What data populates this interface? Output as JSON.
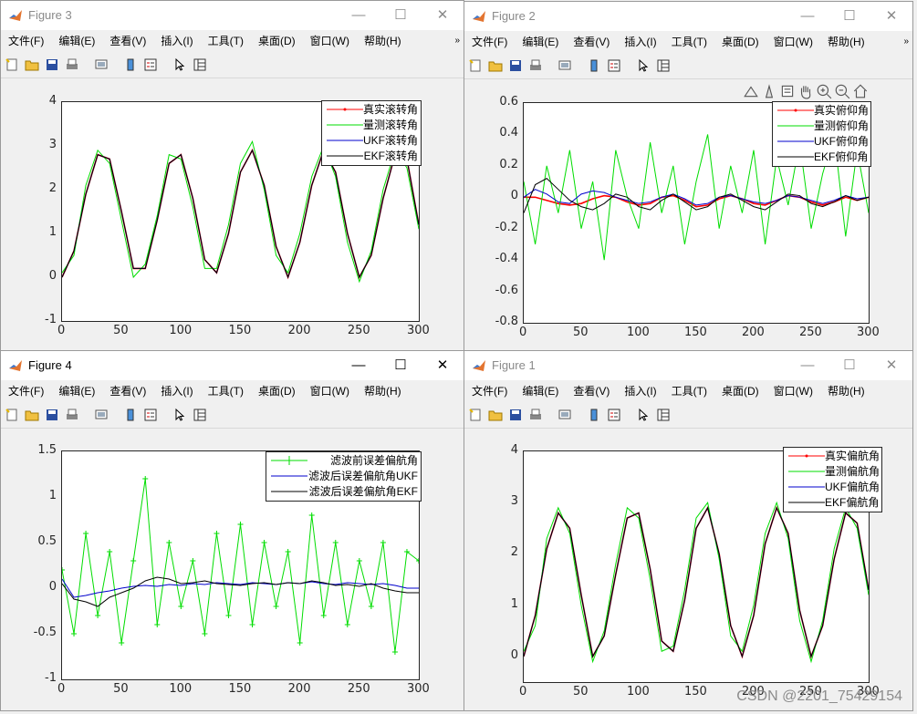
{
  "menus": [
    "文件(F)",
    "编辑(E)",
    "查看(V)",
    "插入(I)",
    "工具(T)",
    "桌面(D)",
    "窗口(W)",
    "帮助(H)"
  ],
  "more_glyph": "»",
  "watermark": "CSDN @2201_75429154",
  "colors": {
    "red": "#ff0000",
    "green": "#00dd00",
    "blue": "#0000cc",
    "black": "#000000",
    "accent": "#0072bd"
  },
  "windows": [
    {
      "id": "fig3",
      "title": "Figure 3",
      "active": false,
      "legend": [
        "真实滚转角",
        "量测滚转角",
        "UKF滚转角",
        "EKF滚转角"
      ],
      "yticks": [
        "4",
        "3",
        "2",
        "1",
        "0",
        "-1"
      ],
      "xticks": [
        "0",
        "50",
        "100",
        "150",
        "200",
        "250",
        "300"
      ],
      "chart_data": {
        "type": "line",
        "xlim": [
          0,
          300
        ],
        "ylim": [
          -1,
          4
        ],
        "x": [
          0,
          10,
          20,
          30,
          40,
          50,
          60,
          70,
          80,
          90,
          100,
          110,
          120,
          130,
          140,
          150,
          160,
          170,
          180,
          190,
          200,
          210,
          220,
          230,
          240,
          250,
          260,
          270,
          280,
          290,
          300
        ],
        "series": [
          {
            "name": "真实滚转角",
            "values": [
              0.0,
              0.6,
              1.9,
              2.8,
              2.7,
              1.5,
              0.2,
              0.2,
              1.3,
              2.6,
              2.8,
              1.8,
              0.4,
              0.1,
              1.0,
              2.4,
              2.9,
              2.1,
              0.7,
              0.0,
              0.8,
              2.1,
              2.9,
              2.4,
              1.0,
              0.0,
              0.5,
              1.8,
              2.8,
              2.7,
              1.2
            ]
          },
          {
            "name": "量测滚转角",
            "values": [
              0.1,
              0.5,
              2.1,
              2.9,
              2.6,
              1.3,
              0.0,
              0.3,
              1.4,
              2.8,
              2.7,
              1.6,
              0.2,
              0.2,
              1.2,
              2.6,
              3.1,
              2.0,
              0.5,
              0.1,
              1.0,
              2.3,
              3.0,
              2.3,
              0.8,
              -0.1,
              0.6,
              2.0,
              2.9,
              2.5,
              1.1
            ]
          },
          {
            "name": "UKF滚转角",
            "values": [
              0.0,
              0.6,
              1.9,
              2.8,
              2.7,
              1.5,
              0.2,
              0.2,
              1.3,
              2.6,
              2.8,
              1.8,
              0.4,
              0.1,
              1.0,
              2.4,
              2.9,
              2.1,
              0.7,
              0.0,
              0.8,
              2.1,
              2.9,
              2.4,
              1.0,
              0.0,
              0.5,
              1.8,
              2.8,
              2.7,
              1.2
            ]
          },
          {
            "name": "EKF滚转角",
            "values": [
              0.0,
              0.6,
              1.9,
              2.8,
              2.7,
              1.5,
              0.2,
              0.2,
              1.3,
              2.6,
              2.8,
              1.8,
              0.4,
              0.1,
              1.0,
              2.4,
              2.9,
              2.1,
              0.7,
              0.0,
              0.8,
              2.1,
              2.9,
              2.4,
              1.0,
              0.0,
              0.5,
              1.8,
              2.8,
              2.7,
              1.2
            ]
          }
        ]
      }
    },
    {
      "id": "fig2",
      "title": "Figure 2",
      "active": false,
      "legend": [
        "真实俯仰角",
        "量测俯仰角",
        "UKF俯仰角",
        "EKF俯仰角"
      ],
      "yticks": [
        "0.6",
        "0.4",
        "0.2",
        "0",
        "-0.2",
        "-0.4",
        "-0.6",
        "-0.8"
      ],
      "xticks": [
        "0",
        "50",
        "100",
        "150",
        "200",
        "250",
        "300"
      ],
      "chart_data": {
        "type": "line",
        "xlim": [
          0,
          300
        ],
        "ylim": [
          -0.8,
          0.6
        ],
        "x": [
          0,
          10,
          20,
          30,
          40,
          50,
          60,
          70,
          80,
          90,
          100,
          110,
          120,
          130,
          140,
          150,
          160,
          170,
          180,
          190,
          200,
          210,
          220,
          230,
          240,
          250,
          260,
          270,
          280,
          290,
          300
        ],
        "series": [
          {
            "name": "真实俯仰角",
            "values": [
              0.0,
              0.0,
              -0.02,
              -0.04,
              -0.05,
              -0.04,
              -0.01,
              0.01,
              0.0,
              -0.03,
              -0.05,
              -0.04,
              0.0,
              0.01,
              -0.02,
              -0.06,
              -0.05,
              -0.01,
              0.01,
              -0.01,
              -0.04,
              -0.05,
              -0.02,
              0.01,
              0.0,
              -0.03,
              -0.05,
              -0.03,
              0.0,
              -0.02,
              0.0
            ]
          },
          {
            "name": "量测俯仰角",
            "values": [
              0.1,
              -0.3,
              0.2,
              -0.1,
              0.3,
              -0.2,
              0.1,
              -0.4,
              0.3,
              0.0,
              -0.2,
              0.35,
              -0.1,
              0.2,
              -0.3,
              0.1,
              0.4,
              -0.2,
              0.2,
              -0.1,
              0.3,
              -0.3,
              0.25,
              -0.05,
              0.35,
              -0.2,
              0.15,
              0.4,
              -0.25,
              0.3,
              -0.1
            ]
          },
          {
            "name": "UKF俯仰角",
            "values": [
              0.0,
              0.05,
              0.02,
              -0.03,
              -0.04,
              0.02,
              0.04,
              0.03,
              0.0,
              -0.02,
              -0.04,
              -0.03,
              0.0,
              0.02,
              -0.01,
              -0.05,
              -0.04,
              0.0,
              0.01,
              -0.01,
              -0.03,
              -0.04,
              -0.02,
              0.01,
              0.0,
              -0.02,
              -0.04,
              -0.02,
              0.01,
              -0.01,
              0.0
            ]
          },
          {
            "name": "EKF俯仰角",
            "values": [
              -0.1,
              0.08,
              0.12,
              0.05,
              -0.02,
              -0.06,
              -0.08,
              -0.04,
              0.02,
              0.0,
              -0.06,
              -0.08,
              -0.02,
              0.02,
              -0.03,
              -0.08,
              -0.06,
              0.0,
              0.02,
              -0.02,
              -0.06,
              -0.08,
              -0.03,
              0.02,
              0.01,
              -0.04,
              -0.06,
              -0.03,
              0.01,
              -0.02,
              0.0
            ]
          }
        ]
      }
    },
    {
      "id": "fig4",
      "title": "Figure 4",
      "active": true,
      "legend": [
        "滤波前误差偏航角",
        "滤波后误差偏航角UKF",
        "滤波后误差偏航角EKF"
      ],
      "yticks": [
        "1.5",
        "1",
        "0.5",
        "0",
        "-0.5",
        "-1"
      ],
      "xticks": [
        "0",
        "50",
        "100",
        "150",
        "200",
        "250",
        "300"
      ],
      "chart_data": {
        "type": "line",
        "xlim": [
          0,
          300
        ],
        "ylim": [
          -1,
          1.5
        ],
        "x": [
          0,
          10,
          20,
          30,
          40,
          50,
          60,
          70,
          80,
          90,
          100,
          110,
          120,
          130,
          140,
          150,
          160,
          170,
          180,
          190,
          200,
          210,
          220,
          230,
          240,
          250,
          260,
          270,
          280,
          290,
          300
        ],
        "series": [
          {
            "name": "滤波前误差偏航角",
            "values": [
              0.2,
              -0.5,
              0.6,
              -0.3,
              0.4,
              -0.6,
              0.3,
              1.2,
              -0.4,
              0.5,
              -0.2,
              0.3,
              -0.5,
              0.6,
              -0.3,
              0.7,
              -0.4,
              0.5,
              -0.2,
              0.4,
              -0.6,
              0.8,
              -0.3,
              0.5,
              -0.4,
              0.3,
              -0.2,
              0.5,
              -0.7,
              0.4,
              0.3
            ]
          },
          {
            "name": "滤波后误差偏航角UKF",
            "values": [
              0.1,
              -0.1,
              -0.08,
              -0.05,
              -0.03,
              0.0,
              0.02,
              0.03,
              0.02,
              0.04,
              0.03,
              0.05,
              0.04,
              0.06,
              0.05,
              0.04,
              0.06,
              0.05,
              0.04,
              0.06,
              0.05,
              0.07,
              0.05,
              0.04,
              0.06,
              0.05,
              0.04,
              0.05,
              0.03,
              0.0,
              0.0
            ]
          },
          {
            "name": "滤波后误差偏航角EKF",
            "values": [
              0.05,
              -0.12,
              -0.15,
              -0.2,
              -0.1,
              -0.05,
              0.0,
              0.08,
              0.12,
              0.1,
              0.05,
              0.06,
              0.08,
              0.05,
              0.04,
              0.03,
              0.05,
              0.06,
              0.04,
              0.06,
              0.05,
              0.08,
              0.06,
              0.03,
              0.04,
              0.02,
              0.05,
              0.0,
              -0.03,
              -0.05,
              -0.05
            ]
          }
        ]
      }
    },
    {
      "id": "fig1",
      "title": "Figure 1",
      "active": false,
      "legend": [
        "真实偏航角",
        "量测偏航角",
        "UKF偏航角",
        "EKF偏航角"
      ],
      "yticks": [
        "4",
        "3",
        "2",
        "1",
        "0"
      ],
      "xticks": [
        "0",
        "50",
        "100",
        "150",
        "200",
        "250",
        "300"
      ],
      "chart_data": {
        "type": "line",
        "xlim": [
          0,
          300
        ],
        "ylim": [
          -0.5,
          4
        ],
        "x": [
          0,
          10,
          20,
          30,
          40,
          50,
          60,
          70,
          80,
          90,
          100,
          110,
          120,
          130,
          140,
          150,
          160,
          170,
          180,
          190,
          200,
          210,
          220,
          230,
          240,
          250,
          260,
          270,
          280,
          290,
          300
        ],
        "series": [
          {
            "name": "真实偏航角",
            "values": [
              0.0,
              0.8,
              2.1,
              2.8,
              2.5,
              1.2,
              0.0,
              0.4,
              1.6,
              2.7,
              2.8,
              1.7,
              0.3,
              0.1,
              1.1,
              2.5,
              2.9,
              2.0,
              0.6,
              0.0,
              0.8,
              2.2,
              2.9,
              2.4,
              0.9,
              0.0,
              0.6,
              1.9,
              2.8,
              2.6,
              1.3
            ]
          },
          {
            "name": "量测偏航角",
            "values": [
              0.1,
              0.6,
              2.3,
              2.9,
              2.4,
              1.0,
              -0.1,
              0.5,
              1.8,
              2.9,
              2.7,
              1.5,
              0.1,
              0.2,
              1.3,
              2.7,
              3.0,
              1.9,
              0.4,
              0.1,
              1.0,
              2.4,
              3.0,
              2.3,
              0.7,
              -0.1,
              0.7,
              2.1,
              2.9,
              2.5,
              1.2
            ]
          },
          {
            "name": "UKF偏航角",
            "values": [
              0.0,
              0.8,
              2.1,
              2.8,
              2.5,
              1.2,
              0.0,
              0.4,
              1.6,
              2.7,
              2.8,
              1.7,
              0.3,
              0.1,
              1.1,
              2.5,
              2.9,
              2.0,
              0.6,
              0.0,
              0.8,
              2.2,
              2.9,
              2.4,
              0.9,
              0.0,
              0.6,
              1.9,
              2.8,
              2.6,
              1.3
            ]
          },
          {
            "name": "EKF偏航角",
            "values": [
              0.0,
              0.8,
              2.1,
              2.8,
              2.5,
              1.2,
              0.0,
              0.4,
              1.6,
              2.7,
              2.8,
              1.7,
              0.3,
              0.1,
              1.1,
              2.5,
              2.9,
              2.0,
              0.6,
              0.0,
              0.8,
              2.2,
              2.9,
              2.4,
              0.9,
              0.0,
              0.6,
              1.9,
              2.8,
              2.6,
              1.3
            ]
          }
        ]
      }
    }
  ]
}
